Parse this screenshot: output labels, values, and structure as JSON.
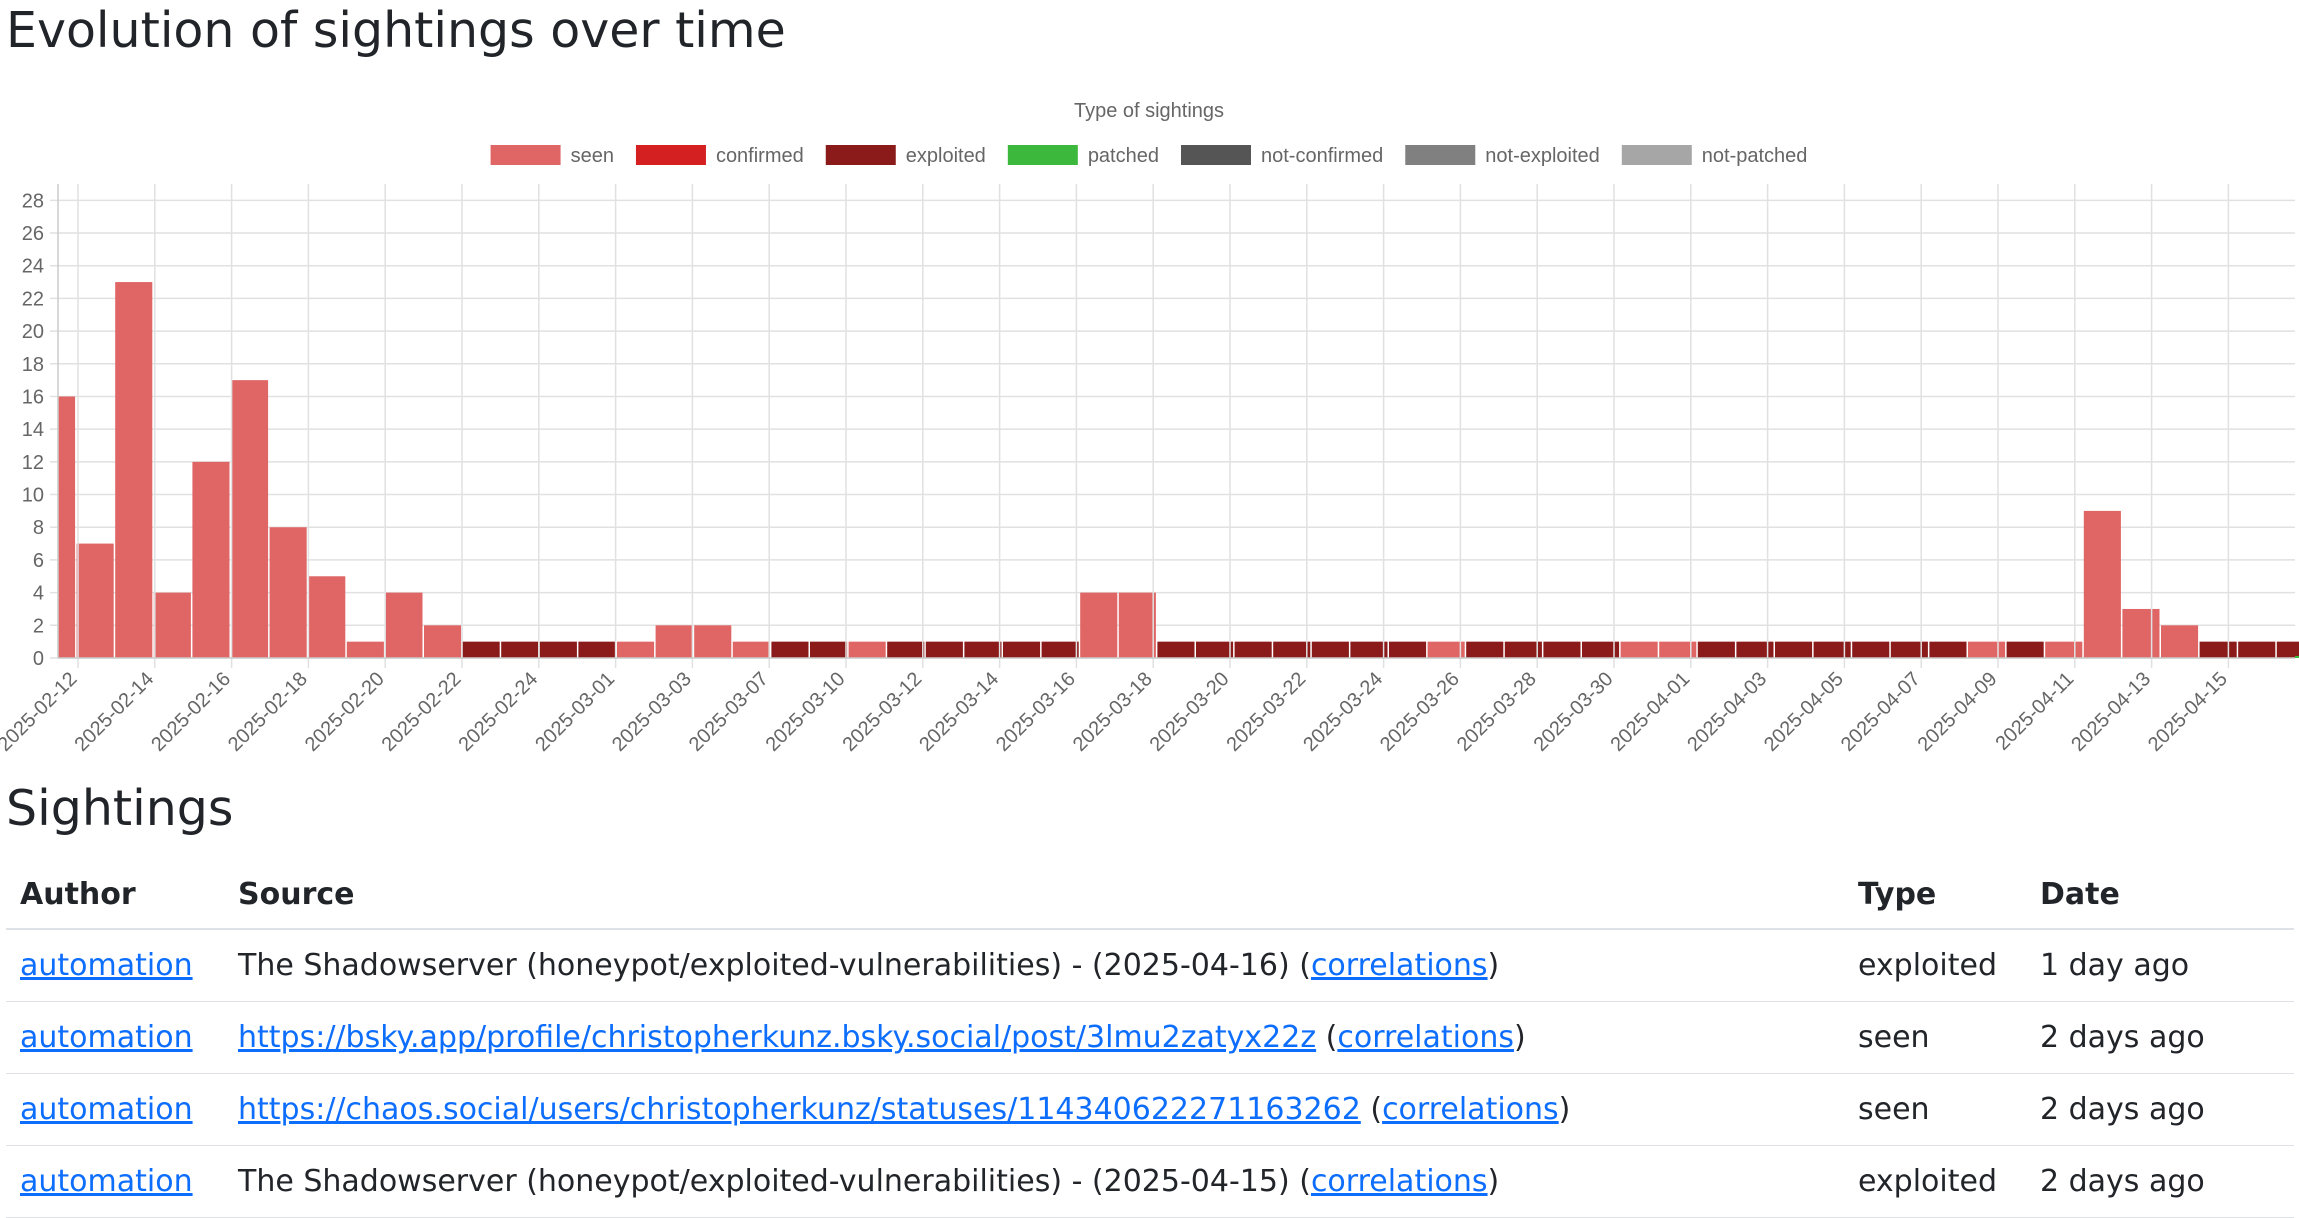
{
  "headings": {
    "evolution": "Evolution of sightings over time",
    "sightings": "Sightings"
  },
  "chart_data": {
    "type": "bar",
    "stacked": true,
    "legend_title": "Type of sightings",
    "legend_position": "top",
    "grid": true,
    "ylim": [
      0,
      29
    ],
    "y_ticks": [
      0,
      2,
      4,
      6,
      8,
      10,
      12,
      14,
      16,
      18,
      20,
      22,
      24,
      26,
      28
    ],
    "tick_labels": [
      "2025-02-12",
      "2025-02-14",
      "2025-02-16",
      "2025-02-18",
      "2025-02-20",
      "2025-02-22",
      "2025-02-24",
      "2025-03-01",
      "2025-03-03",
      "2025-03-07",
      "2025-03-10",
      "2025-03-12",
      "2025-03-14",
      "2025-03-16",
      "2025-03-18",
      "2025-03-20",
      "2025-03-22",
      "2025-03-24",
      "2025-03-26",
      "2025-03-28",
      "2025-03-30",
      "2025-04-01",
      "2025-04-03",
      "2025-04-05",
      "2025-04-07",
      "2025-04-09",
      "2025-04-11",
      "2025-04-13",
      "2025-04-15"
    ],
    "series": [
      {
        "name": "seen",
        "color": "#e06666"
      },
      {
        "name": "confirmed",
        "color": "#d42020"
      },
      {
        "name": "exploited",
        "color": "#8b1a1a"
      },
      {
        "name": "patched",
        "color": "#3cb93c"
      },
      {
        "name": "not-confirmed",
        "color": "#555555"
      },
      {
        "name": "not-exploited",
        "color": "#808080"
      },
      {
        "name": "not-patched",
        "color": "#a6a6a6"
      }
    ],
    "bars": [
      {
        "series": "seen",
        "value": 16
      },
      {
        "series": "seen",
        "value": 7
      },
      {
        "series": "seen",
        "value": 23
      },
      {
        "series": "seen",
        "value": 4
      },
      {
        "series": "seen",
        "value": 12
      },
      {
        "series": "seen",
        "value": 17
      },
      {
        "series": "seen",
        "value": 8
      },
      {
        "series": "seen",
        "value": 5
      },
      {
        "series": "seen",
        "value": 1
      },
      {
        "series": "seen",
        "value": 4
      },
      {
        "series": "seen",
        "value": 2
      },
      {
        "series": "exploited",
        "value": 1
      },
      {
        "series": "exploited",
        "value": 1
      },
      {
        "series": "exploited",
        "value": 1
      },
      {
        "series": "exploited",
        "value": 1
      },
      {
        "series": "seen",
        "value": 1
      },
      {
        "series": "seen",
        "value": 2
      },
      {
        "series": "seen",
        "value": 2
      },
      {
        "series": "seen",
        "value": 1
      },
      {
        "series": "exploited",
        "value": 1
      },
      {
        "series": "exploited",
        "value": 1
      },
      {
        "series": "seen",
        "value": 1
      },
      {
        "series": "exploited",
        "value": 1
      },
      {
        "series": "exploited",
        "value": 1
      },
      {
        "series": "exploited",
        "value": 1
      },
      {
        "series": "exploited",
        "value": 1
      },
      {
        "series": "exploited",
        "value": 1
      },
      {
        "series": "seen",
        "value": 4
      },
      {
        "series": "seen",
        "value": 4
      },
      {
        "series": "exploited",
        "value": 1
      },
      {
        "series": "exploited",
        "value": 1
      },
      {
        "series": "exploited",
        "value": 1
      },
      {
        "series": "exploited",
        "value": 1
      },
      {
        "series": "exploited",
        "value": 1
      },
      {
        "series": "exploited",
        "value": 1
      },
      {
        "series": "exploited",
        "value": 1
      },
      {
        "series": "seen",
        "value": 1
      },
      {
        "series": "exploited",
        "value": 1
      },
      {
        "series": "exploited",
        "value": 1
      },
      {
        "series": "exploited",
        "value": 1
      },
      {
        "series": "exploited",
        "value": 1
      },
      {
        "series": "seen",
        "value": 1
      },
      {
        "series": "seen",
        "value": 1
      },
      {
        "series": "exploited",
        "value": 1
      },
      {
        "series": "exploited",
        "value": 1
      },
      {
        "series": "exploited",
        "value": 1
      },
      {
        "series": "exploited",
        "value": 1
      },
      {
        "series": "exploited",
        "value": 1
      },
      {
        "series": "exploited",
        "value": 1
      },
      {
        "series": "exploited",
        "value": 1
      },
      {
        "series": "seen",
        "value": 1
      },
      {
        "series": "exploited",
        "value": 1
      },
      {
        "series": "seen",
        "value": 1
      },
      {
        "series": "seen",
        "value": 9
      },
      {
        "series": "seen",
        "value": 3
      },
      {
        "series": "seen",
        "value": 2
      },
      {
        "series": "exploited",
        "value": 1
      },
      {
        "series": "exploited",
        "value": 1
      },
      {
        "series": "exploited",
        "value": 1
      }
    ]
  },
  "table": {
    "headers": {
      "author": "Author",
      "source": "Source",
      "type": "Type",
      "date": "Date"
    },
    "rows": [
      {
        "author": "automation",
        "source_text": "The Shadowserver (honeypot/exploited-vulnerabilities) - (2025-04-16) (",
        "source_link": "",
        "correlations": "correlations",
        "close": ")",
        "type": "exploited",
        "date": "1 day ago"
      },
      {
        "author": "automation",
        "source_text": "",
        "source_link": "https://bsky.app/profile/christopherkunz.bsky.social/post/3lmu2zatyx22z",
        "correlations": "correlations",
        "close": ")",
        "type": "seen",
        "date": "2 days ago"
      },
      {
        "author": "automation",
        "source_text": "",
        "source_link": "https://chaos.social/users/christopherkunz/statuses/114340622271163262",
        "correlations": "correlations",
        "close": ")",
        "type": "seen",
        "date": "2 days ago"
      },
      {
        "author": "automation",
        "source_text": "The Shadowserver (honeypot/exploited-vulnerabilities) - (2025-04-15) (",
        "source_link": "",
        "correlations": "correlations",
        "close": ")",
        "type": "exploited",
        "date": "2 days ago"
      }
    ]
  }
}
